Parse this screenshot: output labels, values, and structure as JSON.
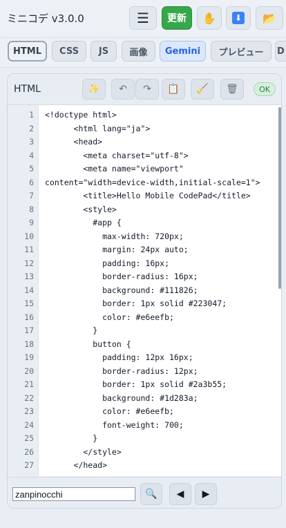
{
  "header": {
    "title": "ミニコデ  v3.0.0",
    "menu_icon": "☰",
    "update_label": "更新",
    "hand_icon": "✋",
    "download_icon": "⬇",
    "folder_icon": "📂"
  },
  "tabs": [
    {
      "label": "HTML",
      "active": true
    },
    {
      "label": "CSS"
    },
    {
      "label": "JS"
    },
    {
      "label": "画像"
    },
    {
      "label": "Gemini"
    },
    {
      "label": "プレビュー"
    },
    {
      "label": "D"
    }
  ],
  "editor": {
    "title": "HTML",
    "toolbar_icons": {
      "magic": "✨",
      "undo": "↶",
      "redo": "↷",
      "paste": "📋",
      "clear": "🧹",
      "delete": "🗑"
    },
    "status": "OK",
    "lines": [
      {
        "n": "1",
        "text": "<!doctype html>"
      },
      {
        "n": "2",
        "text": "      <html lang=\"ja\">"
      },
      {
        "n": "3",
        "text": "      <head>"
      },
      {
        "n": "4",
        "text": "        <meta charset=\"utf-8\">"
      },
      {
        "n": "5",
        "text": "        <meta name=\"viewport\""
      },
      {
        "n": "6",
        "text": "content=\"width=device-width,initial-scale=1\">"
      },
      {
        "n": "7",
        "text": "        <title>Hello Mobile CodePad</title>"
      },
      {
        "n": "8",
        "text": "        <style>"
      },
      {
        "n": "9",
        "text": "          #app {"
      },
      {
        "n": "10",
        "text": "            max-width: 720px;"
      },
      {
        "n": "11",
        "text": "            margin: 24px auto;"
      },
      {
        "n": "12",
        "text": "            padding: 16px;"
      },
      {
        "n": "13",
        "text": "            border-radius: 16px;"
      },
      {
        "n": "14",
        "text": "            background: #111826;"
      },
      {
        "n": "15",
        "text": "            border: 1px solid #223047;"
      },
      {
        "n": "16",
        "text": "            color: #e6eefb;"
      },
      {
        "n": "17",
        "text": "          }"
      },
      {
        "n": "18",
        "text": "          button {"
      },
      {
        "n": "19",
        "text": "            padding: 12px 16px;"
      },
      {
        "n": "20",
        "text": "            border-radius: 12px;"
      },
      {
        "n": "21",
        "text": "            border: 1px solid #2a3b55;"
      },
      {
        "n": "22",
        "text": "            background: #1d283a;"
      },
      {
        "n": "23",
        "text": "            color: #e6eefb;"
      },
      {
        "n": "24",
        "text": "            font-weight: 700;"
      },
      {
        "n": "25",
        "text": "          }"
      },
      {
        "n": "26",
        "text": "        </style>"
      },
      {
        "n": "27",
        "text": "      </head>"
      }
    ]
  },
  "search": {
    "value": "zanpinocchi",
    "search_icon": "🔍",
    "prev_icon": "◀",
    "next_icon": "▶"
  }
}
